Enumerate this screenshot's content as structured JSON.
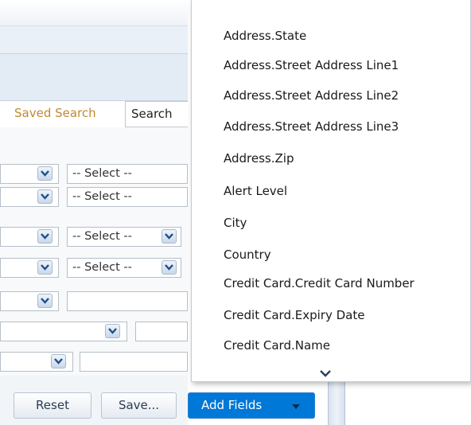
{
  "tabs": {
    "saved_search": "Saved Search",
    "search": "Search"
  },
  "form_rows": [
    {
      "value": "-- Select --"
    },
    {
      "value": "-- Select --"
    },
    {
      "value": "-- Select --"
    },
    {
      "value": "-- Select --"
    }
  ],
  "buttons": {
    "reset": "Reset",
    "save": "Save...",
    "add_fields": "Add Fields"
  },
  "dropdown": {
    "items": [
      "Address.State",
      "Address.Street Address Line1",
      "Address.Street Address Line2",
      "Address.Street Address Line3",
      "Address.Zip",
      "Alert Level",
      "City",
      "Country",
      "Credit Card.Credit Card Number",
      "Credit Card.Expiry Date",
      "Credit Card.Name"
    ],
    "more_icon": "chevron-down-icon"
  },
  "colors": {
    "accent": "#0078d7",
    "saved_tab_text": "#c08a32",
    "header_band": "#e3ebf4"
  }
}
